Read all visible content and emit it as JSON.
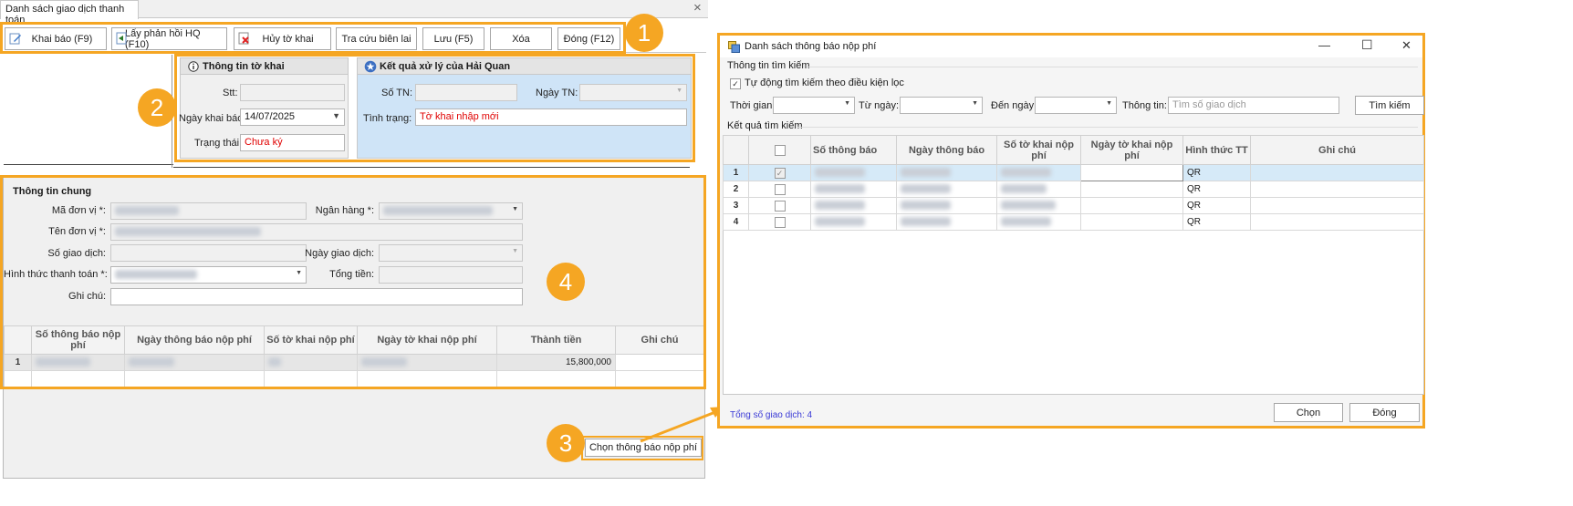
{
  "left_window": {
    "tab_title": "Danh sách giao dịch thanh toán",
    "close_glyph": "×",
    "toolbar": {
      "khai_bao": "Khai báo (F9)",
      "lay_phan_hoi": "Lấy phản hồi HQ (F10)",
      "huy_to_khai": "Hủy tờ khai",
      "tra_cuu": "Tra cứu biên lai",
      "luu": "Lưu (F5)",
      "xoa": "Xóa",
      "dong": "Đóng (F12)"
    },
    "to_khai_panel": {
      "title": "Thông tin tờ khai",
      "stt_label": "Stt:",
      "stt_value": "",
      "ngay_khai_bao_label": "Ngày khai báo:",
      "ngay_khai_bao_value": "14/07/2025",
      "trang_thai_label": "Trạng thái:",
      "trang_thai_value": "Chưa ký"
    },
    "hai_quan_panel": {
      "title": "Kết quả xử lý của Hải Quan",
      "so_tn_label": "Số TN:",
      "ngay_tn_label": "Ngày TN:",
      "tinh_trang_label": "Tình trạng:",
      "tinh_trang_value": "Tờ khai nhập mới"
    },
    "thong_tin_chung": {
      "title": "Thông tin chung",
      "ma_don_vi_label": "Mã đơn vị *:",
      "ngan_hang_label": "Ngân hàng *:",
      "ten_don_vi_label": "Tên đơn vị *:",
      "so_giao_dich_label": "Số giao dịch:",
      "ngay_giao_dich_label": "Ngày giao dịch:",
      "hinh_thuc_label": "Hình thức thanh toán *:",
      "tong_tien_label": "Tổng tiền:",
      "ghi_chu_label": "Ghi chú:"
    },
    "grid": {
      "headers": [
        "Số thông báo nộp phí",
        "Ngày thông báo nộp phí",
        "Số tờ khai nộp phí",
        "Ngày tờ khai nộp phí",
        "Thành tiền",
        "Ghi chú"
      ],
      "rows": [
        {
          "num": "1",
          "thanh_tien": "15,800,000"
        }
      ]
    },
    "chon_button": "Chọn thông báo nộp phí"
  },
  "badges": [
    "1",
    "2",
    "3",
    "4"
  ],
  "dialog": {
    "title": "Danh sách thông báo nộp phí",
    "minimize": "—",
    "maximize": "☐",
    "close": "✕",
    "search_section": "Thông tin tìm kiếm",
    "auto_search_label": "Tự động tìm kiếm theo điều kiện lọc",
    "auto_search_checked": true,
    "thoi_gian_label": "Thời gian:",
    "tu_ngay_label": "Từ ngày:",
    "den_ngay_label": "Đến ngày:",
    "thong_tin_label": "Thông tin:",
    "thong_tin_placeholder": "Tìm số giao dịch",
    "tim_kiem_button": "Tìm kiếm",
    "result_section": "Kết quả tìm kiếm",
    "grid_headers": [
      "Số thông báo",
      "Ngày thông báo",
      "Số tờ khai nộp phí",
      "Ngày tờ khai nộp phí",
      "Hình thức TT",
      "Ghi chú"
    ],
    "rows": [
      {
        "num": "1",
        "checked": true,
        "hinh_thuc": "QR"
      },
      {
        "num": "2",
        "checked": false,
        "hinh_thuc": "QR"
      },
      {
        "num": "3",
        "checked": false,
        "hinh_thuc": "QR"
      },
      {
        "num": "4",
        "checked": false,
        "hinh_thuc": "QR"
      }
    ],
    "total_label": "Tổng số giao dịch: 4",
    "chon_button": "Chọn",
    "dong_button": "Đóng"
  },
  "colors": {
    "highlight": "#f5a623",
    "panel_blue": "#cfe4f7",
    "selected_row": "#d6eaf8",
    "link_blue": "#3a3ad6"
  },
  "icons": [
    "edit-icon",
    "refresh-icon",
    "cancel-doc-icon",
    "info-icon",
    "star-icon",
    "app-icon"
  ]
}
